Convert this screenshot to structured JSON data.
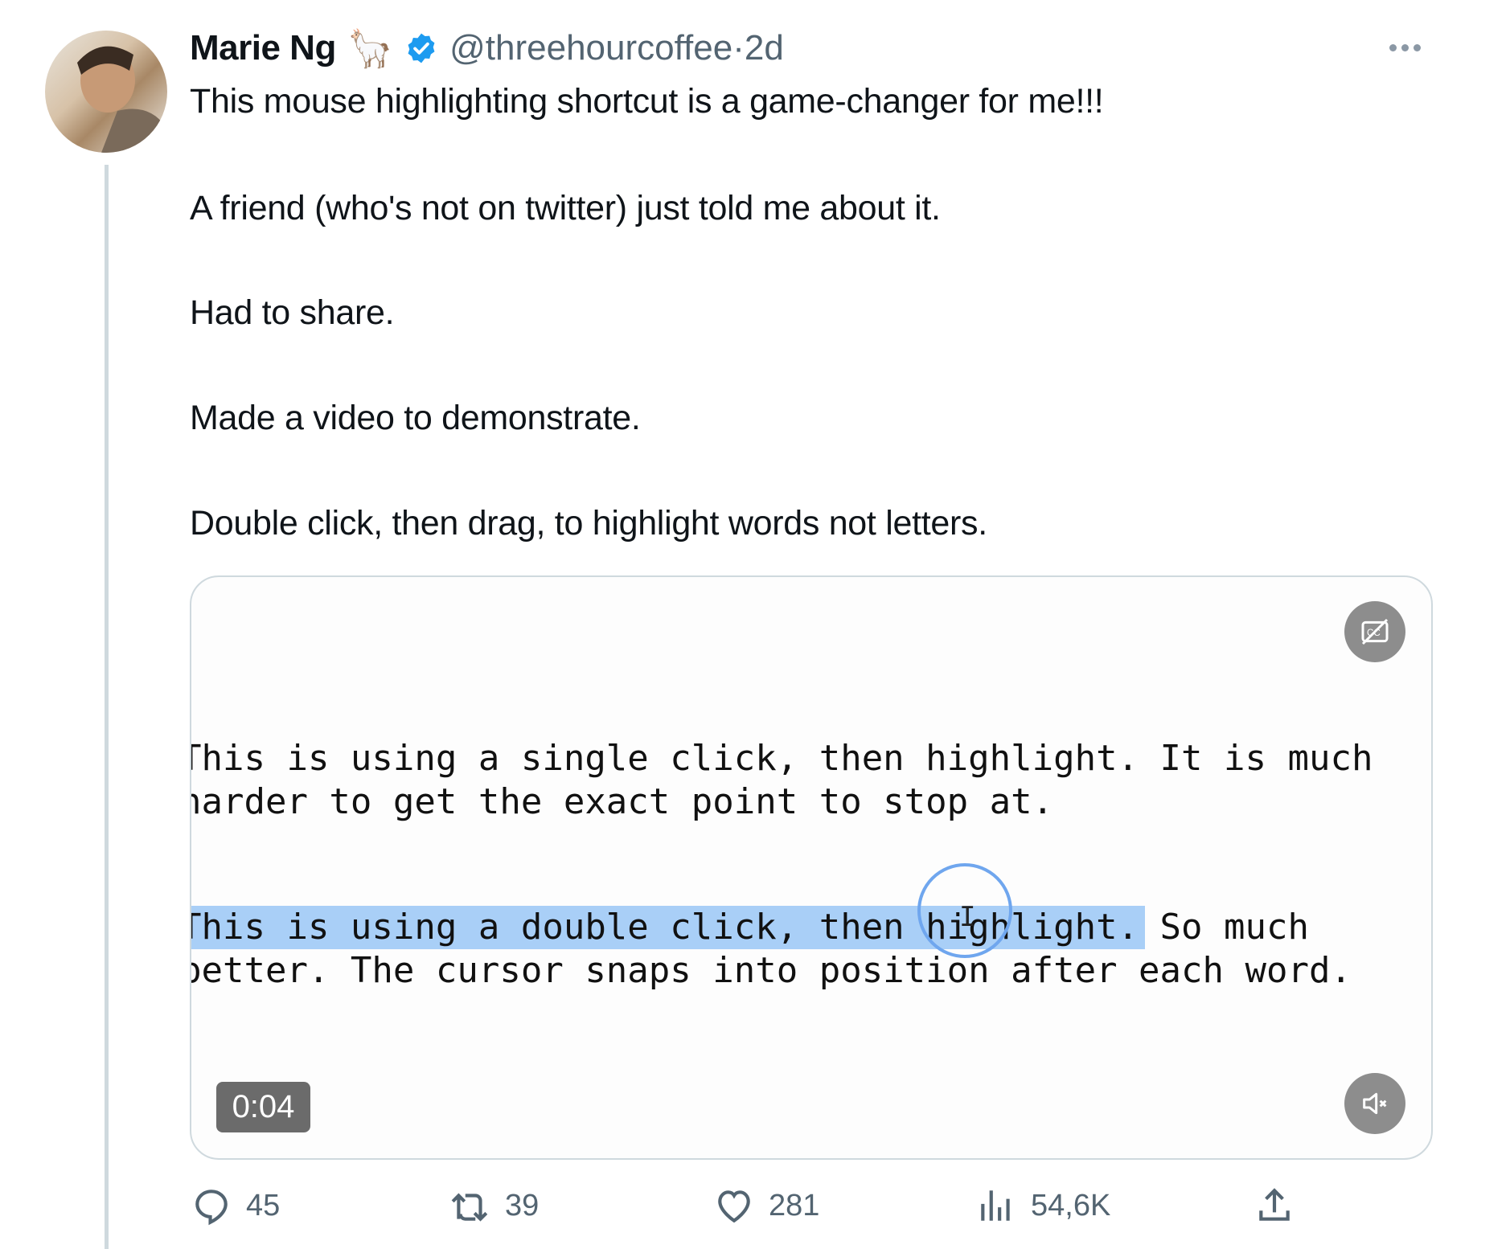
{
  "tweet": {
    "author_name": "Marie Ng",
    "author_emoji": "🦙",
    "handle": "@threehourcoffee",
    "separator": "·",
    "time": "2d",
    "verified": true,
    "paragraphs": [
      "This mouse highlighting shortcut is a game-changer for me!!!",
      "A friend (who's not on twitter) just told me about it.",
      "Had to share.",
      "Made a video to demonstrate.",
      "Double click, then drag, to highlight words not letters."
    ]
  },
  "video": {
    "lines": [
      "This is using a single click, then highlight. It is much",
      "harder to get the exact point to stop at.",
      "This is using a double click, then highlight. So much",
      "better. The cursor snaps into position after each word."
    ],
    "timestamp": "0:04",
    "highlight_color": "#a9cff7",
    "captions_icon": "captions-off-icon",
    "mute_icon": "volume-muted-icon"
  },
  "actions": {
    "replies": "45",
    "retweets": "39",
    "likes": "281",
    "views": "54,6K"
  },
  "colors": {
    "verified": "#1d9bf0",
    "secondary_text": "#536471",
    "thread_line": "#cfd9de"
  }
}
